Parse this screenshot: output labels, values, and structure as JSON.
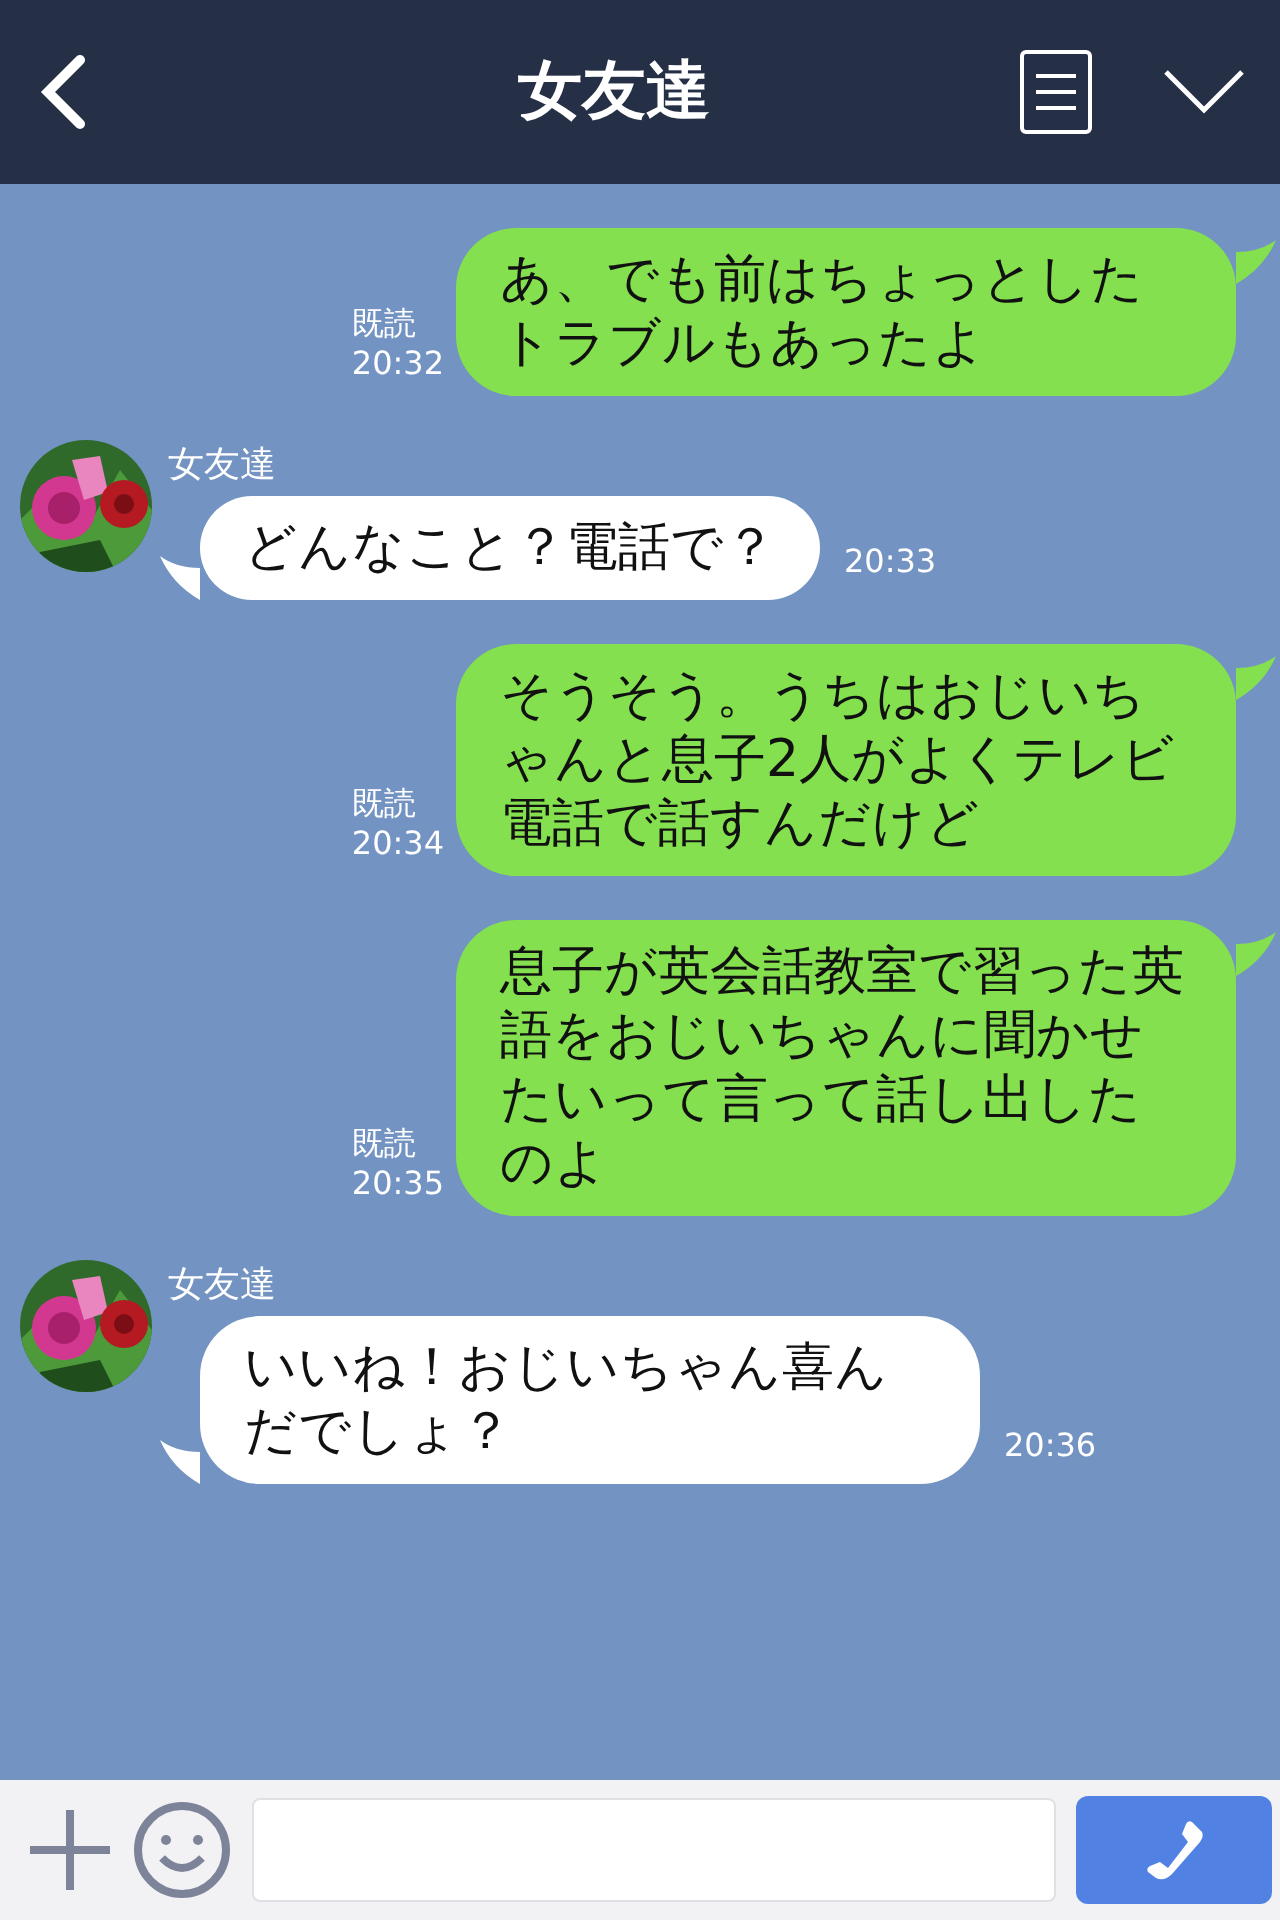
{
  "header": {
    "title": "女友達"
  },
  "messages": [
    {
      "kind": "sent",
      "text": "あ、でも前はちょっとしたトラブルもあったよ",
      "read": "既読",
      "time": "20:32"
    },
    {
      "kind": "received",
      "name": "女友達",
      "text": "どんなこと？電話で？",
      "time": "20:33"
    },
    {
      "kind": "sent",
      "text": "そうそう。うちはおじいちゃんと息子2人がよくテレビ電話で話すんだけど",
      "read": "既読",
      "time": "20:34"
    },
    {
      "kind": "sent",
      "text": "息子が英会話教室で習った英語をおじいちゃんに聞かせたいって言って話し出したのよ",
      "read": "既読",
      "time": "20:35"
    },
    {
      "kind": "received",
      "name": "女友達",
      "text": "いいね！おじいちゃん喜んだでしょ？",
      "time": "20:36"
    }
  ]
}
